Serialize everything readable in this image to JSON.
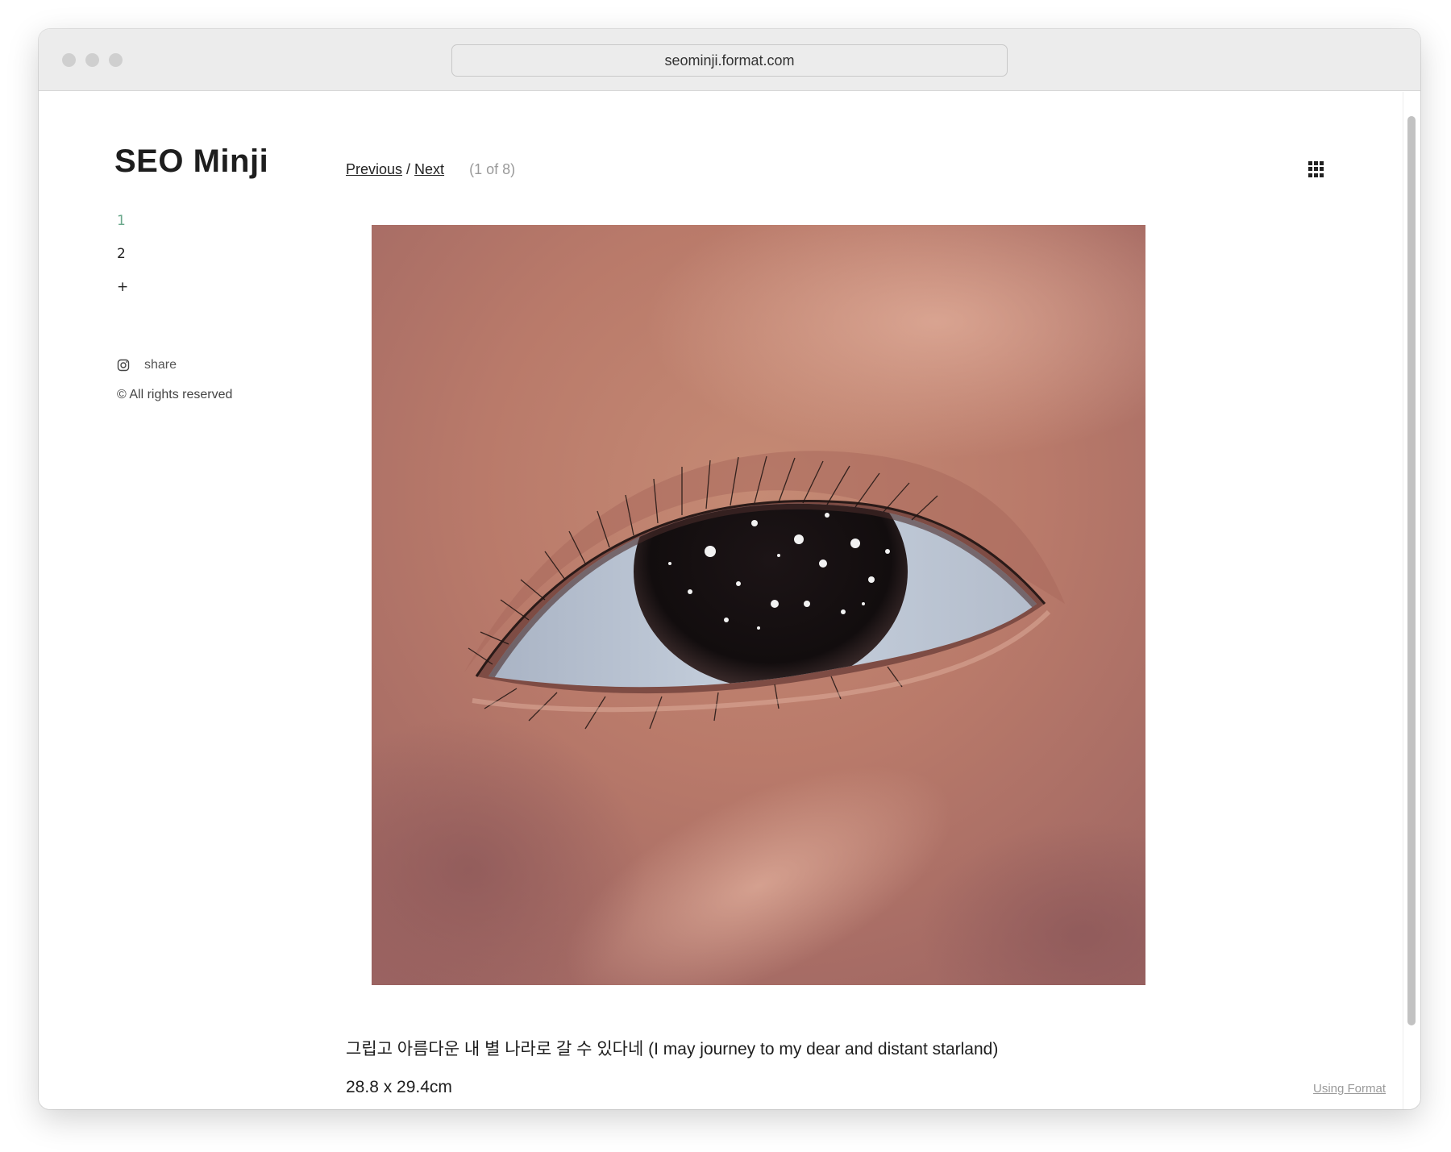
{
  "browser": {
    "url": "seominji.format.com"
  },
  "site": {
    "title": "SEO Minji"
  },
  "gallery_nav": {
    "previous": "Previous",
    "separator": "/",
    "next": "Next",
    "counter": "(1 of 8)"
  },
  "sidebar": {
    "items": [
      {
        "label": "1",
        "active": true
      },
      {
        "label": "2",
        "active": false
      },
      {
        "label": "+",
        "active": false
      }
    ],
    "share_label": "share",
    "copyright": "© All rights reserved"
  },
  "artwork": {
    "caption": "그립고 아름다운 내 별 나라로 갈 수 있다네 (I may journey to my dear and distant starland)",
    "dimensions": "28.8 x 29.4cm"
  },
  "footer": {
    "using_format": "Using Format"
  },
  "colors": {
    "accent": "#6aa88b",
    "text": "#1e1e1e",
    "muted": "#9a9a9a"
  },
  "icons": {
    "menu": "grid-icon",
    "social": "instagram-icon"
  }
}
